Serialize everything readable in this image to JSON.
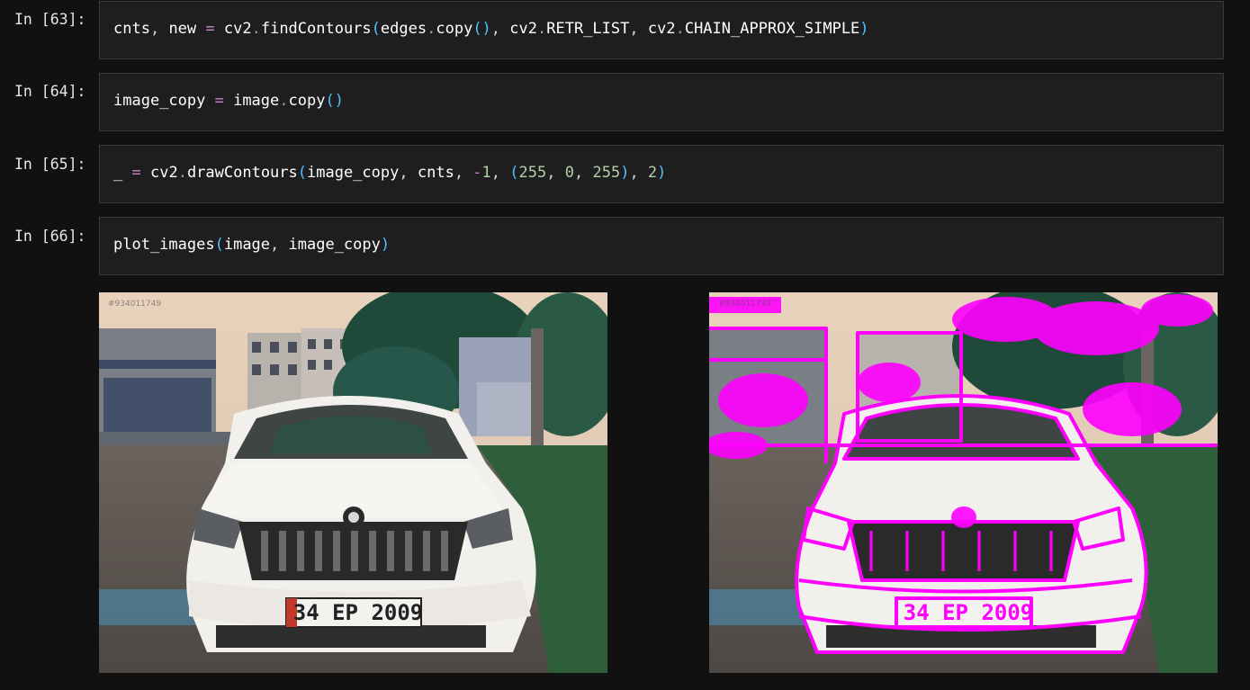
{
  "cells": [
    {
      "prompt": "In [63]:",
      "tokens": [
        {
          "t": "cnts",
          "c": "t-name"
        },
        {
          "t": ", ",
          "c": "t-punct"
        },
        {
          "t": "new",
          "c": "t-name"
        },
        {
          "t": " = ",
          "c": "t-op"
        },
        {
          "t": "cv2",
          "c": "t-name"
        },
        {
          "t": ".",
          "c": "t-dot"
        },
        {
          "t": "findContours",
          "c": "t-name"
        },
        {
          "t": "(",
          "c": "t-paren"
        },
        {
          "t": "edges",
          "c": "t-name"
        },
        {
          "t": ".",
          "c": "t-dot"
        },
        {
          "t": "copy",
          "c": "t-name"
        },
        {
          "t": "()",
          "c": "t-paren"
        },
        {
          "t": ", ",
          "c": "t-punct"
        },
        {
          "t": "cv2",
          "c": "t-name"
        },
        {
          "t": ".",
          "c": "t-dot"
        },
        {
          "t": "RETR_LIST",
          "c": "t-name"
        },
        {
          "t": ", ",
          "c": "t-punct"
        },
        {
          "t": "cv2",
          "c": "t-name"
        },
        {
          "t": ".",
          "c": "t-dot"
        },
        {
          "t": "CHAIN_APPROX_SIMPLE",
          "c": "t-name"
        },
        {
          "t": ")",
          "c": "t-paren"
        }
      ]
    },
    {
      "prompt": "In [64]:",
      "tokens": [
        {
          "t": "image_copy",
          "c": "t-name"
        },
        {
          "t": " = ",
          "c": "t-op"
        },
        {
          "t": "image",
          "c": "t-name"
        },
        {
          "t": ".",
          "c": "t-dot"
        },
        {
          "t": "copy",
          "c": "t-name"
        },
        {
          "t": "()",
          "c": "t-paren"
        }
      ]
    },
    {
      "prompt": "In [65]:",
      "tokens": [
        {
          "t": "_",
          "c": "t-name"
        },
        {
          "t": " = ",
          "c": "t-op"
        },
        {
          "t": "cv2",
          "c": "t-name"
        },
        {
          "t": ".",
          "c": "t-dot"
        },
        {
          "t": "drawContours",
          "c": "t-name"
        },
        {
          "t": "(",
          "c": "t-paren"
        },
        {
          "t": "image_copy",
          "c": "t-name"
        },
        {
          "t": ", ",
          "c": "t-punct"
        },
        {
          "t": "cnts",
          "c": "t-name"
        },
        {
          "t": ", ",
          "c": "t-punct"
        },
        {
          "t": "-",
          "c": "t-op"
        },
        {
          "t": "1",
          "c": "t-num"
        },
        {
          "t": ", ",
          "c": "t-punct"
        },
        {
          "t": "(",
          "c": "t-paren"
        },
        {
          "t": "255",
          "c": "t-num"
        },
        {
          "t": ", ",
          "c": "t-punct"
        },
        {
          "t": "0",
          "c": "t-num"
        },
        {
          "t": ", ",
          "c": "t-punct"
        },
        {
          "t": "255",
          "c": "t-num"
        },
        {
          "t": ")",
          "c": "t-paren"
        },
        {
          "t": ", ",
          "c": "t-punct"
        },
        {
          "t": "2",
          "c": "t-num"
        },
        {
          "t": ")",
          "c": "t-paren"
        }
      ]
    },
    {
      "prompt": "In [66]:",
      "tokens": [
        {
          "t": "plot_images",
          "c": "t-name"
        },
        {
          "t": "(",
          "c": "t-paren"
        },
        {
          "t": "image",
          "c": "t-name"
        },
        {
          "t": ", ",
          "c": "t-punct"
        },
        {
          "t": "image_copy",
          "c": "t-name"
        },
        {
          "t": ")",
          "c": "t-paren"
        }
      ]
    }
  ],
  "output": {
    "left_image": {
      "watermark": "#934011749",
      "plate": "34 EP 2009"
    },
    "right_image": {
      "watermark": "#934011749",
      "plate": "34 EP 2009",
      "contour_color": "#ff00ff"
    }
  },
  "colors": {
    "background": "#111111",
    "cell_bg": "#1e1e1e",
    "operator": "#c586c0",
    "paren": "#4fc1ff",
    "number": "#b5cea8",
    "contour": "#ff00ff"
  }
}
